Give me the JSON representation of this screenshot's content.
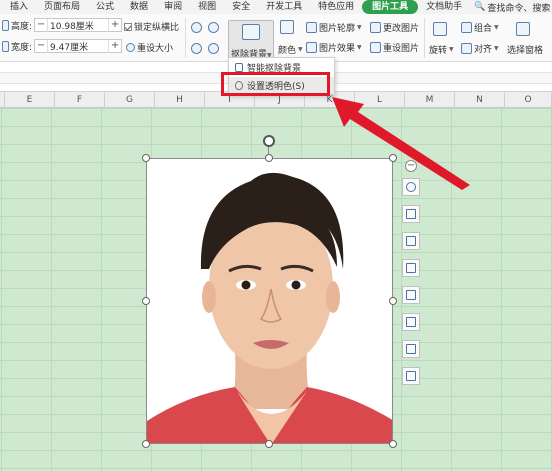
{
  "tabs": {
    "items": [
      "插入",
      "页面布局",
      "公式",
      "数据",
      "审阅",
      "视图",
      "安全",
      "开发工具",
      "特色应用",
      "图片工具",
      "文档助手"
    ],
    "search_label": "查找命令、搜索"
  },
  "ribbon": {
    "height_label": "高度:",
    "height_value": "10.98厘米",
    "width_label": "宽度:",
    "width_value": "9.47厘米",
    "lock_ratio_label": "锁定纵横比",
    "reset_size_label": "重设大小",
    "remove_bg_label": "抠除背景",
    "color_label": "颜色",
    "outline_label": "图片轮廓",
    "effect_label": "图片效果",
    "change_pic_label": "更改图片",
    "reset_pic_label": "重设图片",
    "group_label": "组合",
    "rotate_label": "旋转",
    "align_label": "对齐",
    "select_pane_label": "选择窗格"
  },
  "columns": [
    "E",
    "F",
    "G",
    "H",
    "I",
    "J",
    "K",
    "L",
    "M",
    "N",
    "O"
  ],
  "dropdown": {
    "item1": "智能抠除背景",
    "item2": "设置透明色(S)"
  },
  "colors": {
    "accent": "#2e9e4f",
    "highlight": "#e0192a",
    "sheet_bg": "#cfe8d0"
  }
}
